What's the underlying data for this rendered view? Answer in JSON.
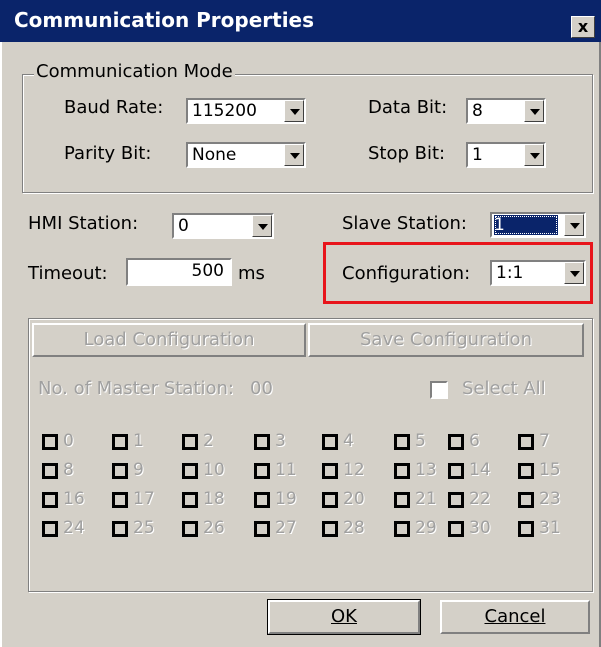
{
  "window": {
    "title": "Communication Properties",
    "close_label": "x"
  },
  "comm_mode": {
    "legend": "Communication Mode",
    "baud_rate_label": "Baud Rate:",
    "baud_rate_value": "115200",
    "data_bit_label": "Data Bit:",
    "data_bit_value": "8",
    "parity_bit_label": "Parity Bit:",
    "parity_bit_value": "None",
    "stop_bit_label": "Stop Bit:",
    "stop_bit_value": "1"
  },
  "settings": {
    "hmi_station_label": "HMI Station:",
    "hmi_station_value": "0",
    "slave_station_label": "Slave Station:",
    "slave_station_value": "1",
    "timeout_label": "Timeout:",
    "timeout_value": "500",
    "timeout_unit": "ms",
    "configuration_label": "Configuration:",
    "configuration_value": "1:1"
  },
  "master": {
    "load_button": "Load Configuration",
    "save_button": "Save Configuration",
    "count_label": "No. of Master Station:",
    "count_value": "00",
    "select_all_label": "Select All",
    "stations": [
      "0",
      "1",
      "2",
      "3",
      "4",
      "5",
      "6",
      "7",
      "8",
      "9",
      "10",
      "11",
      "12",
      "13",
      "14",
      "15",
      "16",
      "17",
      "18",
      "19",
      "20",
      "21",
      "22",
      "23",
      "24",
      "25",
      "26",
      "27",
      "28",
      "29",
      "30",
      "31"
    ]
  },
  "footer": {
    "ok_label": "OK",
    "cancel_label": "Cancel"
  },
  "colors": {
    "titlebar": "#0a246a",
    "face": "#d4d0c8",
    "highlight_frame": "#e8141b"
  }
}
